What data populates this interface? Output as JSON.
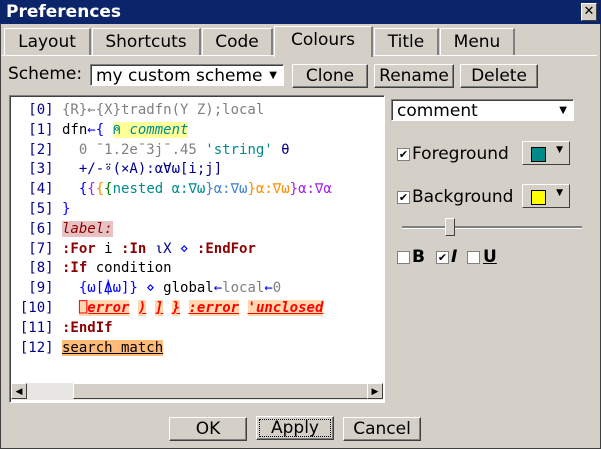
{
  "window": {
    "title": "Preferences",
    "close_label": "✕"
  },
  "tabs": [
    {
      "label": "Layout"
    },
    {
      "label": "Shortcuts"
    },
    {
      "label": "Code"
    },
    {
      "label": "Colours"
    },
    {
      "label": "Title"
    },
    {
      "label": "Menu"
    }
  ],
  "scheme": {
    "label": "Scheme:",
    "selected": "my custom scheme",
    "clone_label": "Clone",
    "rename_label": "Rename",
    "delete_label": "Delete"
  },
  "element_select": {
    "selected": "comment"
  },
  "foreground": {
    "label": "Foreground",
    "checked": true,
    "color": "#008b8b"
  },
  "background": {
    "label": "Background",
    "checked": true,
    "color": "#ffff00"
  },
  "style_toggles": {
    "bold": {
      "label": "B",
      "checked": false
    },
    "italic": {
      "label": "I",
      "checked": true
    },
    "underline": {
      "label": "U",
      "checked": false
    }
  },
  "slider": {
    "value_fraction": 0.25
  },
  "code_lines": [
    {
      "num": "[0]",
      "segments": [
        {
          "text": "{R}←{X}tradfn(Y Z);local",
          "cls": "gray"
        }
      ]
    },
    {
      "num": "[1]",
      "segments": [
        {
          "text": "dfn",
          "cls": "plain"
        },
        {
          "text": "←{ ",
          "cls": "blue"
        },
        {
          "text": "⍝ comment",
          "cls": "comment"
        }
      ]
    },
    {
      "num": "[2]",
      "segments": [
        {
          "text": "  0 ¯1.2e¯3j¯.45 ",
          "cls": "gray"
        },
        {
          "text": "'string'",
          "cls": "teal"
        },
        {
          "text": " θ",
          "cls": "navy"
        }
      ]
    },
    {
      "num": "[3]",
      "segments": [
        {
          "text": "  +/-⍤(×A):αⱯω[i;j]",
          "cls": "navy"
        }
      ]
    },
    {
      "num": "[4]",
      "segments": [
        {
          "text": "  {",
          "cls": "blue"
        },
        {
          "text": "{",
          "cls": "purple"
        },
        {
          "text": "{",
          "cls": "orange"
        },
        {
          "text": "{",
          "cls": "green"
        },
        {
          "text": "nested α:∇ω",
          "cls": "teal"
        },
        {
          "text": "}α:∇ω",
          "cls": "cyanblue"
        },
        {
          "text": "}α:∇ω",
          "cls": "orange"
        },
        {
          "text": "}α:∇α",
          "cls": "purple"
        }
      ]
    },
    {
      "num": "[5]",
      "segments": [
        {
          "text": "}",
          "cls": "blue"
        }
      ]
    },
    {
      "num": "[6]",
      "segments": [
        {
          "text": "label:",
          "cls": "label"
        }
      ]
    },
    {
      "num": "[7]",
      "segments": [
        {
          "text": ":For",
          "cls": "kw"
        },
        {
          "text": " i ",
          "cls": "plain"
        },
        {
          "text": ":In",
          "cls": "kw"
        },
        {
          "text": " ⍳X ",
          "cls": "navy"
        },
        {
          "text": "⋄",
          "cls": "blue"
        },
        {
          "text": " ",
          "cls": "plain"
        },
        {
          "text": ":EndFor",
          "cls": "kw"
        }
      ]
    },
    {
      "num": "[8]",
      "segments": [
        {
          "text": ":If",
          "cls": "kw"
        },
        {
          "text": " condition",
          "cls": "plain"
        }
      ]
    },
    {
      "num": "[9]",
      "segments": [
        {
          "text": "  {ω[⍋ω]}",
          "cls": "blue"
        },
        {
          "text": " ⋄ ",
          "cls": "blue"
        },
        {
          "text": "global",
          "cls": "plain"
        },
        {
          "text": "←",
          "cls": "blue"
        },
        {
          "text": "local",
          "cls": "gray"
        },
        {
          "text": "←",
          "cls": "blue"
        },
        {
          "text": "0",
          "cls": "gray"
        }
      ]
    },
    {
      "num": "[10]",
      "segments": [
        {
          "text": "  ",
          "cls": "plain"
        },
        {
          "text": "⎕error",
          "cls": "err"
        },
        {
          "text": " ",
          "cls": "plain"
        },
        {
          "text": ")",
          "cls": "err"
        },
        {
          "text": " ",
          "cls": "plain"
        },
        {
          "text": "]",
          "cls": "err"
        },
        {
          "text": " ",
          "cls": "plain"
        },
        {
          "text": "}",
          "cls": "err"
        },
        {
          "text": " ",
          "cls": "plain"
        },
        {
          "text": ":error",
          "cls": "err"
        },
        {
          "text": " ",
          "cls": "plain"
        },
        {
          "text": "'unclosed",
          "cls": "err"
        }
      ]
    },
    {
      "num": "[11]",
      "segments": [
        {
          "text": ":EndIf",
          "cls": "kw"
        }
      ]
    },
    {
      "num": "[12]",
      "segments": [
        {
          "text": "search match",
          "cls": "search"
        }
      ]
    }
  ],
  "buttons": {
    "ok": "OK",
    "apply": "Apply",
    "cancel": "Cancel"
  },
  "colors": {
    "titlebar": "#0c246a",
    "comment_fg": "#008b8b",
    "comment_bg": "#ffff99",
    "error_bg": "#ffd8b0",
    "error_fg": "#ff0000",
    "search_bg": "#ffbb77",
    "label_bg": "#e8c2c2",
    "keyword": "#8b0000"
  }
}
